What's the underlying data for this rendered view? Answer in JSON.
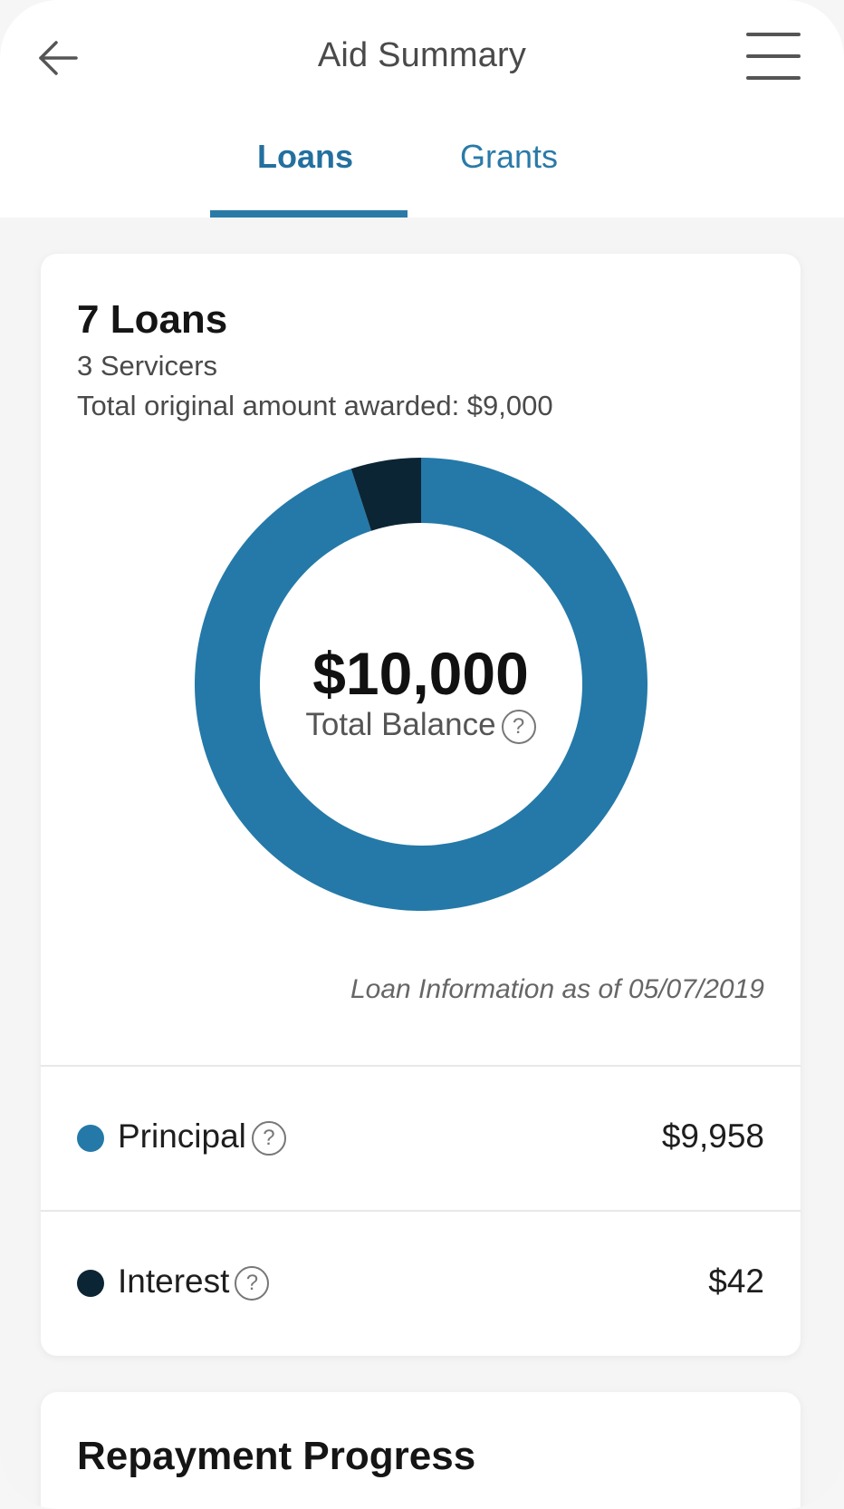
{
  "header": {
    "title": "Aid Summary"
  },
  "tabs": [
    {
      "label": "Loans",
      "active": true
    },
    {
      "label": "Grants",
      "active": false
    }
  ],
  "summary": {
    "loans_count": "7 Loans",
    "servicers": "3 Servicers",
    "original_amount": "Total original amount awarded: $9,000",
    "total_balance": "$10,000",
    "total_balance_label": "Total Balance",
    "as_of": "Loan Information as of 05/07/2019"
  },
  "breakdown": [
    {
      "label": "Principal",
      "value": "$9,958",
      "color": "#2479a8"
    },
    {
      "label": "Interest",
      "value": "$42",
      "color": "#0b2535"
    }
  ],
  "chart_data": {
    "type": "pie",
    "categories": [
      "Principal",
      "Interest"
    ],
    "values": [
      9958,
      42
    ],
    "colors": [
      "#2479a8",
      "#0b2535"
    ],
    "title": ""
  },
  "repayment": {
    "title": "Repayment Progress"
  },
  "colors": {
    "accent": "#2a7aa8",
    "principal": "#2479a8",
    "interest": "#0b2535"
  }
}
